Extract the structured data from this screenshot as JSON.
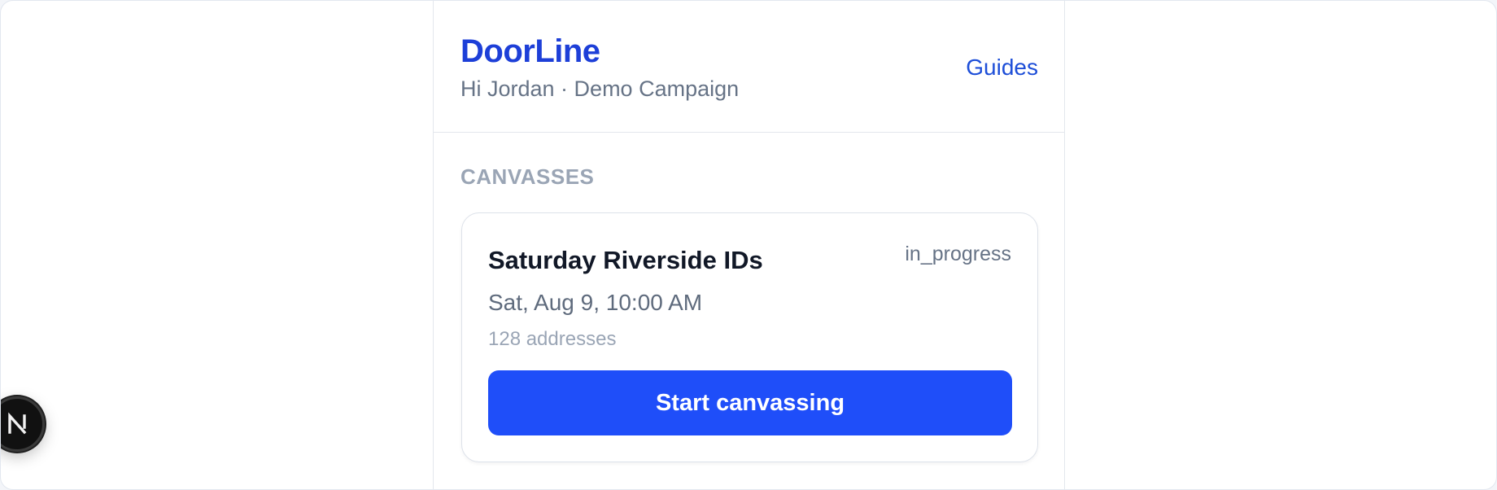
{
  "header": {
    "brand": "DoorLine",
    "subtitle": "Hi Jordan · Demo Campaign",
    "guides_link": "Guides"
  },
  "main": {
    "section_label": "CANVASSES",
    "canvasses": [
      {
        "title": "Saturday Riverside IDs",
        "status": "in_progress",
        "date": "Sat, Aug 9, 10:00 AM",
        "address_count": "128 addresses",
        "action_label": "Start canvassing"
      }
    ]
  },
  "dev_badge": {
    "icon": "nextjs-n-icon"
  },
  "colors": {
    "brand": "#1d3fd8",
    "accent_button": "#1f4ef9",
    "muted_text": "#667386",
    "section_label": "#9aa5b5"
  }
}
